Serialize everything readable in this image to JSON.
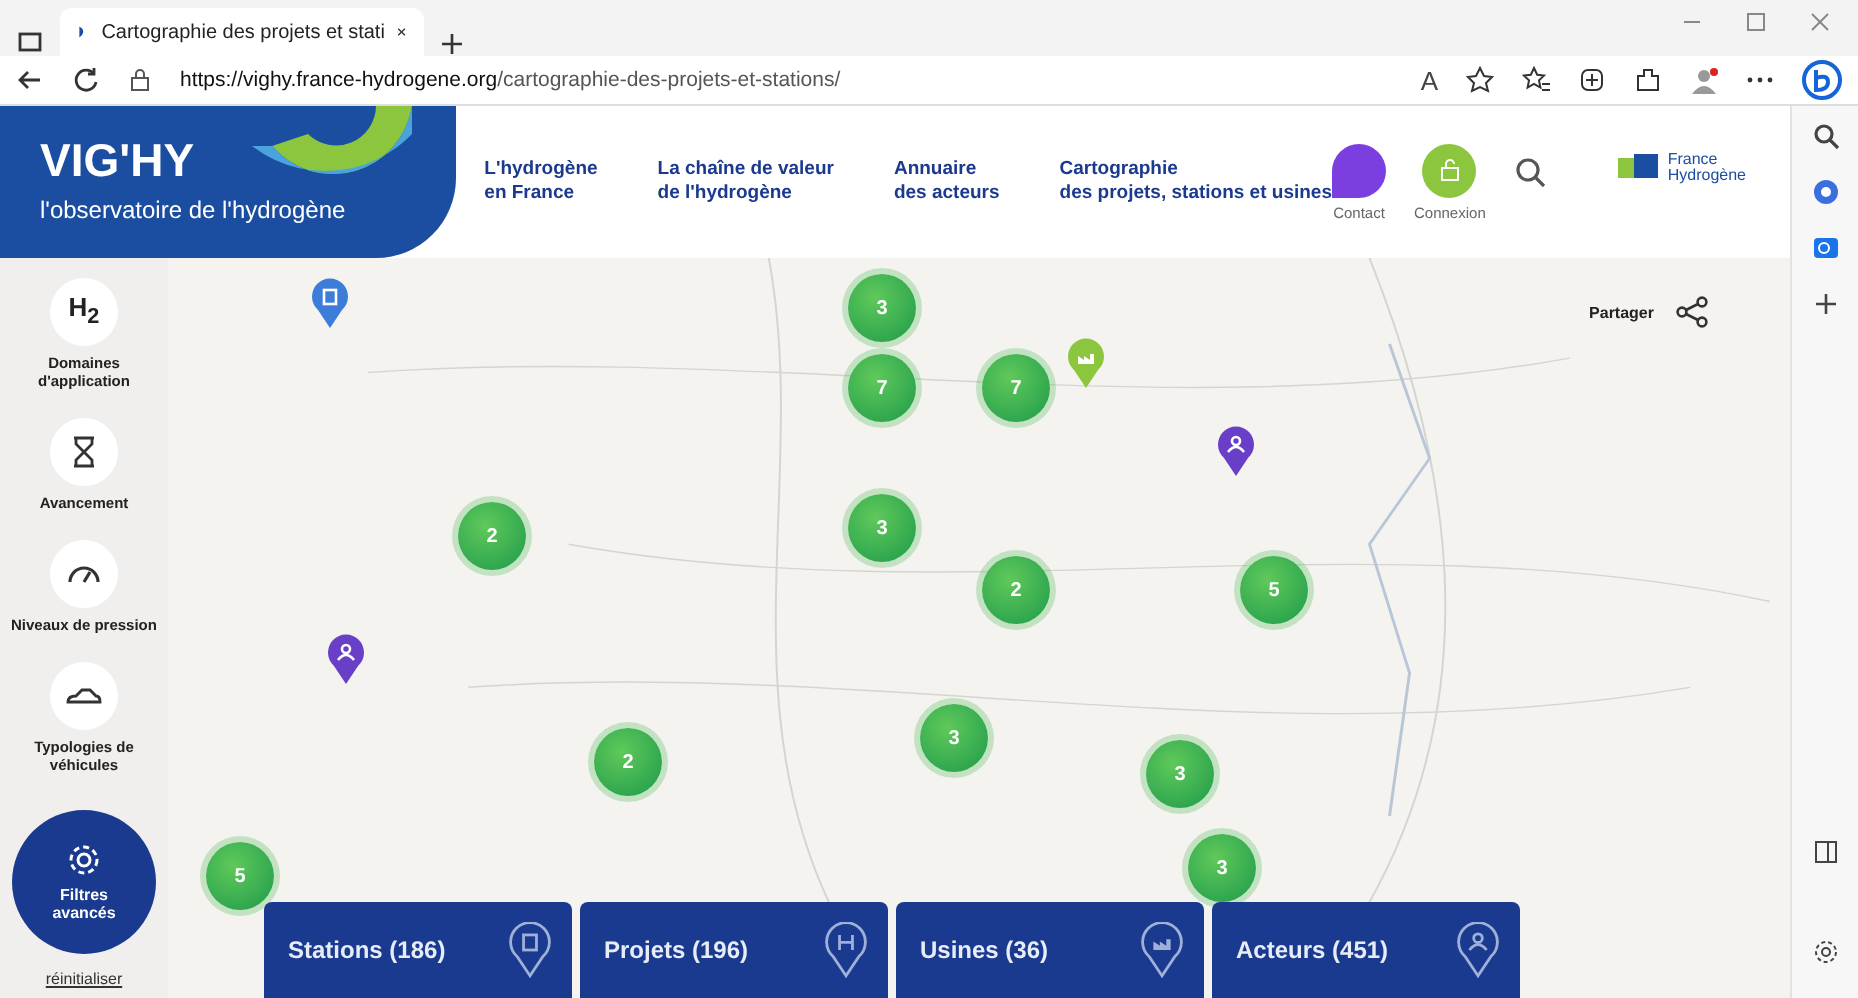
{
  "browser": {
    "tab_title": "Cartographie des projets et stati",
    "url_host": "https://vighy.france-hydrogene.org",
    "url_path": "/cartographie-des-projets-et-stations/",
    "reader_label": "A"
  },
  "header": {
    "logo_title": "VIG'HY",
    "logo_subtitle": "l'observatoire de l'hydrogène",
    "nav": [
      {
        "lines": [
          "L'hydrogène",
          "en France"
        ]
      },
      {
        "lines": [
          "La chaîne de valeur",
          "de l'hydrogène"
        ]
      },
      {
        "lines": [
          "Annuaire",
          "des acteurs"
        ]
      },
      {
        "lines": [
          "Cartographie",
          "des projets, stations et usines"
        ]
      }
    ],
    "contact": "Contact",
    "login": "Connexion",
    "partner_lines": [
      "France",
      "Hydrogène"
    ]
  },
  "sidebar": {
    "filters": [
      {
        "kind": "h2",
        "icon_text": "H$_{2}$",
        "label": "Domaines d'application"
      },
      {
        "kind": "hourglass",
        "label": "Avancement"
      },
      {
        "kind": "gauge",
        "label": "Niveaux de pression"
      },
      {
        "kind": "car",
        "label": "Typologies de véhicules"
      }
    ],
    "advanced": "Filtres avancés",
    "reset": "réinitialiser"
  },
  "map": {
    "share": "Partager",
    "clusters": [
      {
        "count": "3"
      },
      {
        "count": "7"
      },
      {
        "count": "7"
      },
      {
        "count": "2"
      },
      {
        "count": "3"
      },
      {
        "count": "2"
      },
      {
        "count": "5"
      },
      {
        "count": "2"
      },
      {
        "count": "3"
      },
      {
        "count": "3"
      },
      {
        "count": "3"
      },
      {
        "count": "5"
      }
    ],
    "pins": [
      {
        "kind": "station"
      },
      {
        "kind": "factory"
      },
      {
        "kind": "actor"
      },
      {
        "kind": "actor"
      }
    ]
  },
  "bottom_tabs": [
    {
      "kind": "station",
      "label": "Stations (186)"
    },
    {
      "kind": "project",
      "label": "Projets (196)"
    },
    {
      "kind": "factory",
      "label": "Usines (36)"
    },
    {
      "kind": "actor",
      "label": "Acteurs (451)"
    }
  ]
}
